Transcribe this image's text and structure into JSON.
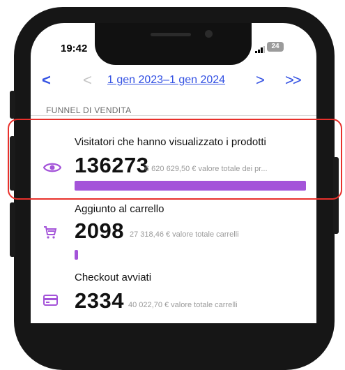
{
  "status_bar": {
    "time": "19:42",
    "battery": "24"
  },
  "nav": {
    "prev_label": "<",
    "prev_disabled_label": "<",
    "date_range": "1 gen 2023–1 gen 2024",
    "next_label": ">",
    "next_next_label": ">>"
  },
  "section": {
    "title": "FUNNEL DI VENDITA"
  },
  "funnel": [
    {
      "label": "Visitatori che hanno visualizzato i prodotti",
      "value": "136273",
      "sub": "6 620 629,50 € valore totale dei pr...",
      "icon": "eye-icon",
      "bar_fraction": 1.0,
      "selected": true
    },
    {
      "label": "Aggiunto al carrello",
      "value": "2098",
      "sub": "27 318,46 € valore totale carrelli",
      "icon": "cart-icon",
      "bar_fraction": 0.015
    },
    {
      "label": "Checkout avviati",
      "value": "2334",
      "sub": "40 022,70 € valore totale carrelli",
      "icon": "card-icon"
    }
  ],
  "colors": {
    "accent": "#3452e3",
    "bar": "#a454d9",
    "highlight": "#e8302b"
  }
}
